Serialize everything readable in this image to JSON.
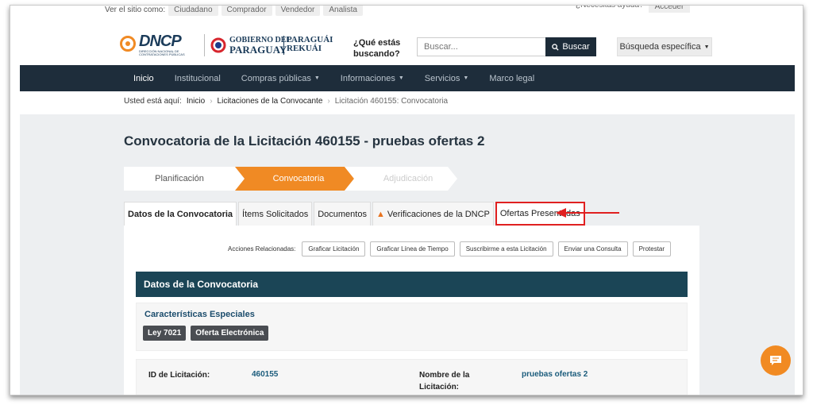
{
  "utility": {
    "view_as_label": "Ver el sitio como:",
    "roles": [
      "Ciudadano",
      "Comprador",
      "Vendedor",
      "Analista"
    ],
    "help": "¿Necesitas ayuda?",
    "login": "Acceder"
  },
  "header": {
    "dncp_logo": "DNCP",
    "dncp_sub": "DIRECCIÓN NACIONAL DE CONTRATACIONES PÚBLICAS",
    "gob_line1": "GOBIERNO DEL",
    "gob_line2": "PARAGUAY",
    "gob_line3a": "PARAGUÁI",
    "gob_line3b": "REKUÁI",
    "question": "¿Qué estás buscando?",
    "search_placeholder": "Buscar...",
    "search_button": "Buscar",
    "advanced_search": "Búsqueda específica"
  },
  "nav": {
    "items": [
      {
        "label": "Inicio"
      },
      {
        "label": "Institucional"
      },
      {
        "label": "Compras públicas"
      },
      {
        "label": "Informaciones"
      },
      {
        "label": "Servicios"
      },
      {
        "label": "Marco legal"
      }
    ]
  },
  "breadcrumb": {
    "prefix": "Usted está aquí:",
    "items": [
      "Inicio",
      "Licitaciones de la Convocante",
      "Licitación 460155: Convocatoria"
    ]
  },
  "page": {
    "title": "Convocatoria de la Licitación 460155 - pruebas ofertas 2"
  },
  "steps": [
    "Planificación",
    "Convocatoria",
    "Adjudicación"
  ],
  "tabs": [
    "Datos de la Convocatoria",
    "Ítems Solicitados",
    "Documentos",
    "Verificaciones de la DNCP",
    "Ofertas Presentadas"
  ],
  "acciones": {
    "label": "Acciones Relacionadas:",
    "buttons": [
      "Graficar Licitación",
      "Graficar Línea de Tiempo",
      "Suscribirme a esta Licitación",
      "Enviar una Consulta",
      "Protestar"
    ]
  },
  "section": {
    "title": "Datos de la Convocatoria",
    "caract_title": "Características Especiales",
    "badges": [
      "Ley 7021",
      "Oferta Electrónica"
    ],
    "id_label": "ID de Licitación:",
    "id_value": "460155",
    "name_label_1": "Nombre de la",
    "name_label_2": "Licitación:",
    "name_value": "pruebas ofertas 2"
  },
  "colors": {
    "nav_bg": "#1e2d3b",
    "accent_orange": "#f08a24",
    "section_header": "#1b4556",
    "highlight_red": "#e02020"
  }
}
